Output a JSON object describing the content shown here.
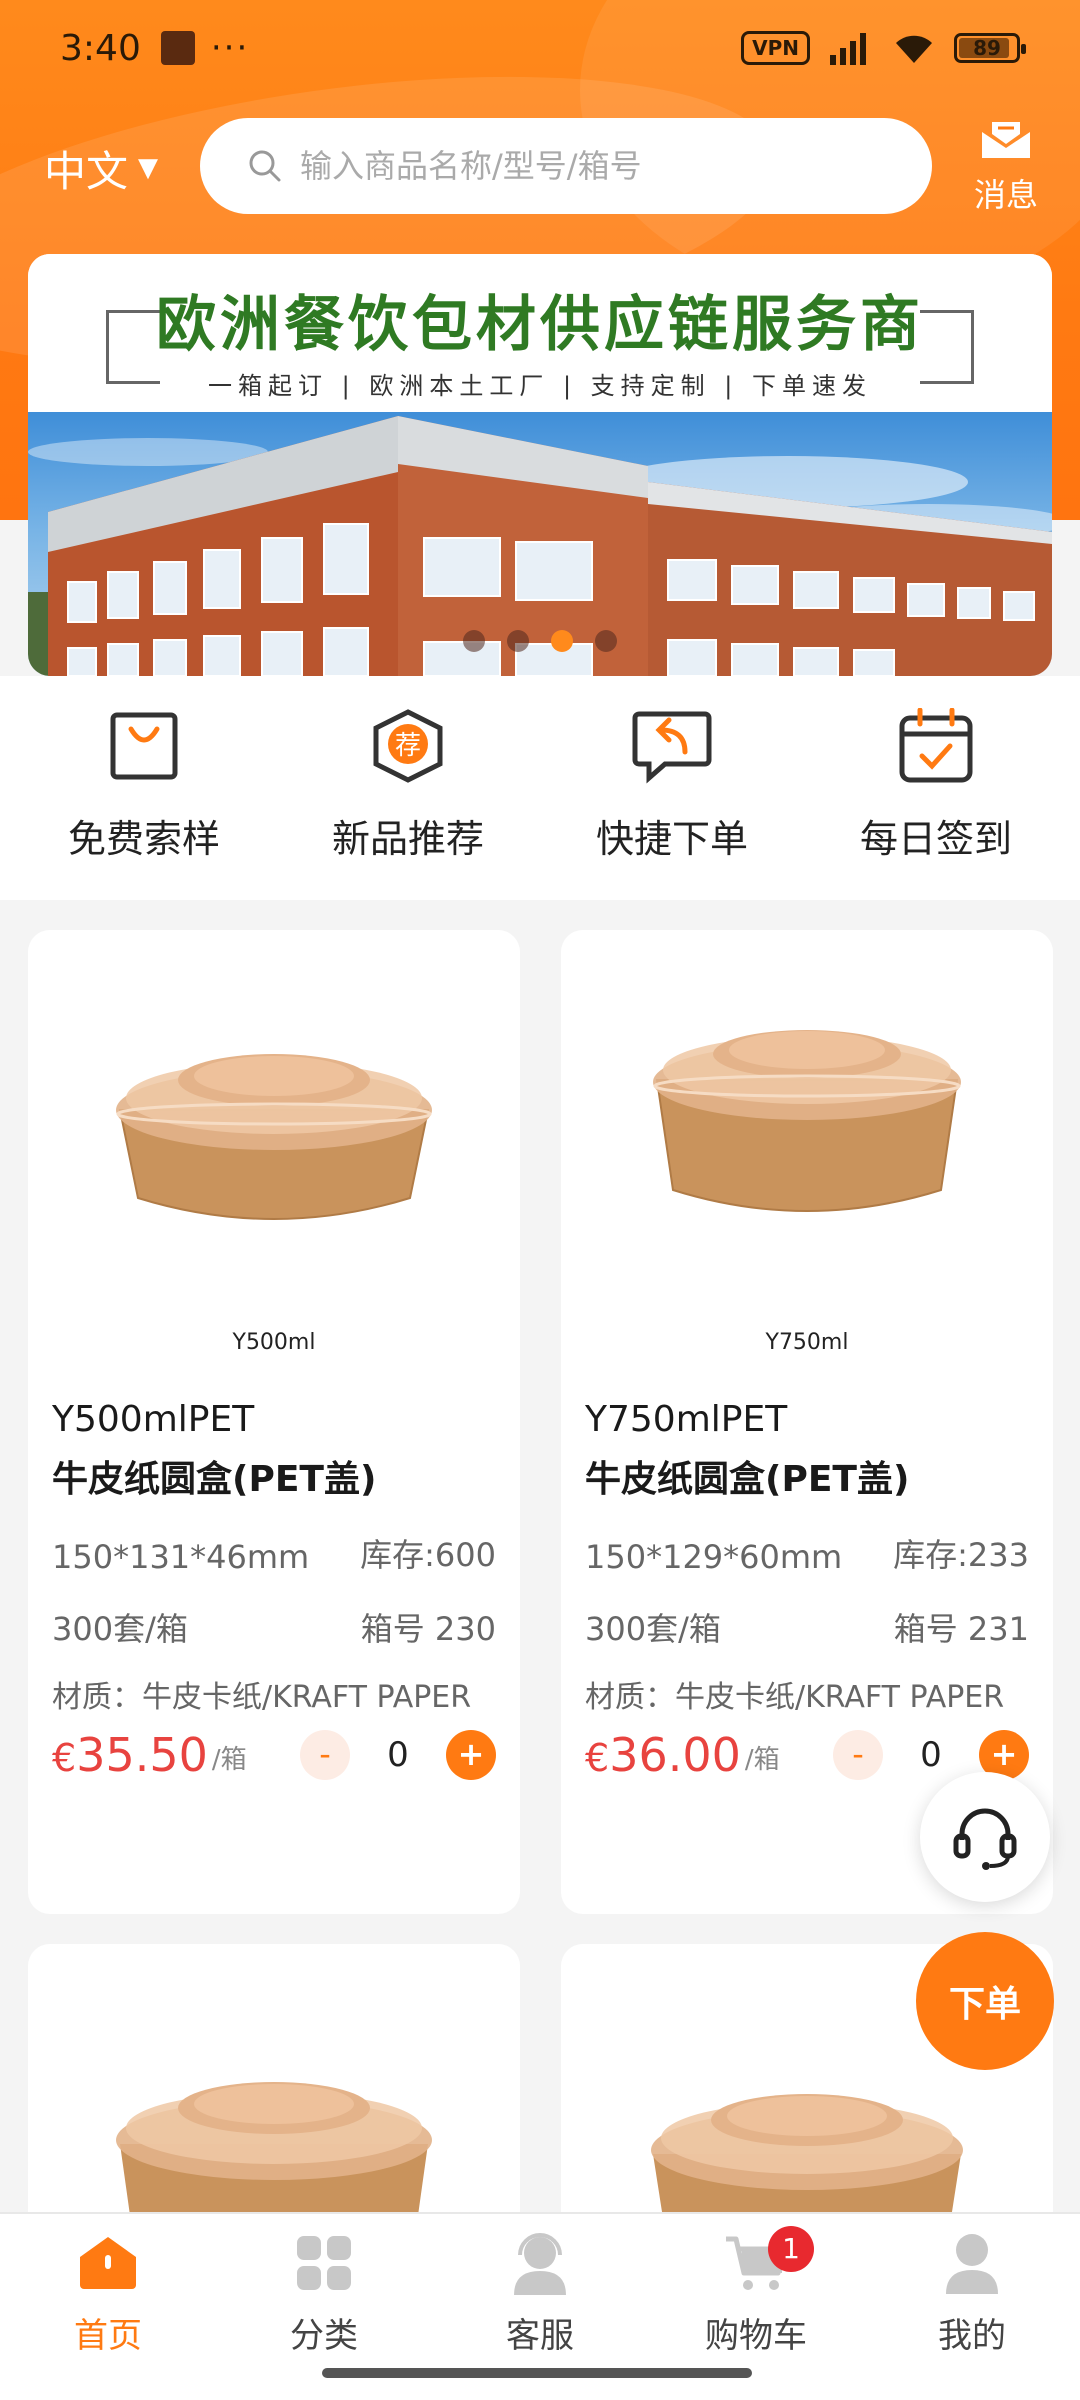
{
  "status_bar": {
    "time": "3:40",
    "dots": "···",
    "vpn": "VPN",
    "battery": "89"
  },
  "header": {
    "language": "中文",
    "search_placeholder": "输入商品名称/型号/箱号",
    "message_label": "消息"
  },
  "banner": {
    "title": "欧洲餐饮包材供应链服务商",
    "subtitle": "一箱起订 | 欧洲本土工厂 | 支持定制 | 下单速发",
    "slide_count": 4,
    "active_slide": 3
  },
  "quick_actions": [
    {
      "label": "免费索样",
      "icon": "bag-icon"
    },
    {
      "label": "新品推荐",
      "icon": "recommend-icon",
      "glyph": "荐"
    },
    {
      "label": "快捷下单",
      "icon": "quick-order-icon"
    },
    {
      "label": "每日签到",
      "icon": "calendar-check-icon"
    }
  ],
  "products": [
    {
      "image_caption": "Y500ml",
      "name_line1": "Y500mlPET",
      "name_line2": "牛皮纸圆盒(PET盖)",
      "dimensions": "150*131*46mm",
      "stock": "库存:600",
      "pack": "300套/箱",
      "box_no": "箱号 230",
      "material": "材质：牛皮卡纸/KRAFT PAPER",
      "currency": "€",
      "price": "35.50",
      "unit": "/箱",
      "qty": "0",
      "minus": "-",
      "plus": "+"
    },
    {
      "image_caption": "Y750ml",
      "name_line1": "Y750mlPET",
      "name_line2": "牛皮纸圆盒(PET盖)",
      "dimensions": "150*129*60mm",
      "stock": "库存:233",
      "pack": "300套/箱",
      "box_no": "箱号 231",
      "material": "材质：牛皮卡纸/KRAFT PAPER",
      "currency": "€",
      "price": "36.00",
      "unit": "/箱",
      "qty": "0",
      "minus": "-",
      "plus": "+"
    }
  ],
  "floating": {
    "order_label": "下单"
  },
  "bottom_nav": [
    {
      "label": "首页",
      "icon": "home-icon",
      "active": true
    },
    {
      "label": "分类",
      "icon": "category-icon"
    },
    {
      "label": "客服",
      "icon": "support-agent-icon"
    },
    {
      "label": "购物车",
      "icon": "cart-icon",
      "badge": "1"
    },
    {
      "label": "我的",
      "icon": "profile-icon"
    }
  ],
  "colors": {
    "accent": "#ff7a12",
    "price": "#e8433f",
    "banner_title": "#2f7a23",
    "badge": "#e8292f"
  }
}
